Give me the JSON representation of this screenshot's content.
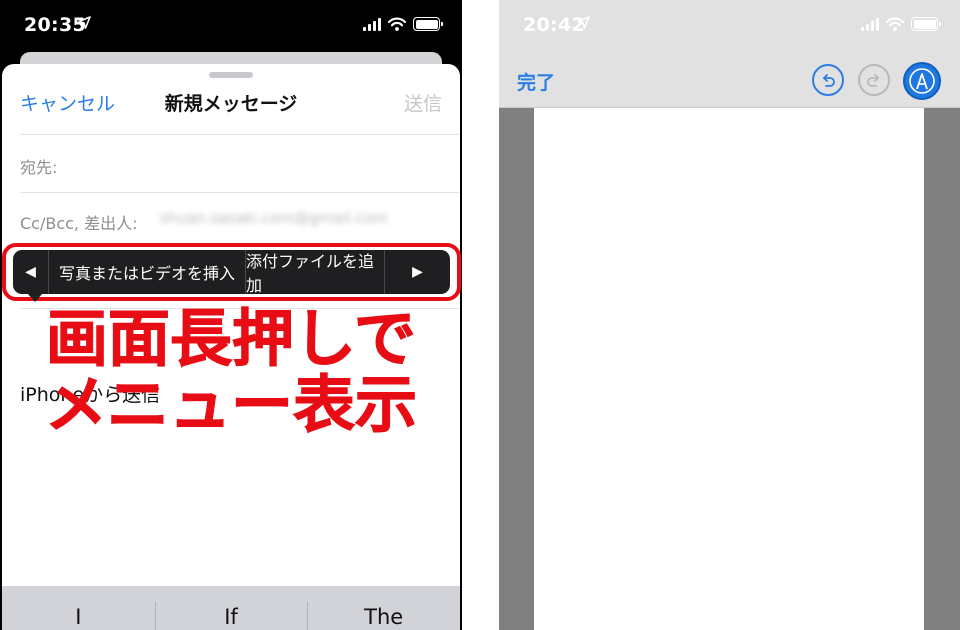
{
  "left_screen": {
    "status_bar": {
      "time": "20:35"
    },
    "nav": {
      "cancel": "キャンセル",
      "title": "新規メッセージ",
      "send": "送信"
    },
    "fields": {
      "to_label": "宛先:",
      "cc_label": "Cc/Bcc, 差出人:",
      "cc_value": "shuan.sasaki.com@gmail.com"
    },
    "edit_menu": {
      "item1": "写真またはビデオを挿入",
      "item2": "添付ファイルを追加",
      "left_arrow": "◀",
      "right_arrow": "▶"
    },
    "body": {
      "signature": "iPhoneから送信"
    },
    "caption": {
      "line1": "画面長押しで",
      "line2": "メニュー表示"
    },
    "keyboard": {
      "suggestions": [
        "I",
        "If",
        "The"
      ]
    }
  },
  "right_screen": {
    "status_bar": {
      "time": "20:42"
    },
    "toolbar": {
      "done": "完了"
    }
  },
  "colors": {
    "accent": "#2a7ee6",
    "highlight": "#e80c14",
    "menu_bg": "#1f1f21"
  },
  "icons": [
    "location-arrow-icon",
    "signal-icon",
    "wifi-icon",
    "battery-icon",
    "undo-icon",
    "redo-icon",
    "markup-pen-icon"
  ]
}
